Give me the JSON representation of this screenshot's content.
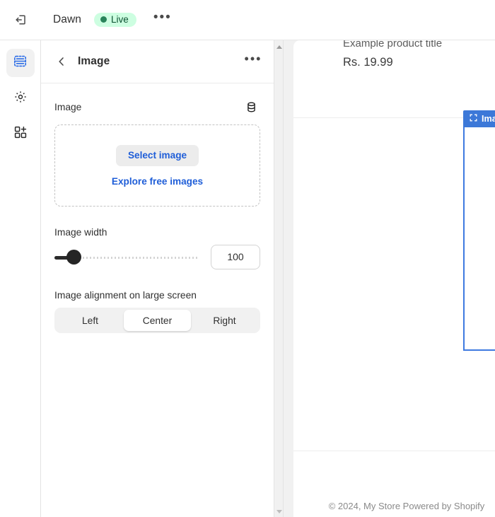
{
  "topbar": {
    "exit_icon": "exit-icon",
    "store_name": "Dawn",
    "status_badge": "Live",
    "more_label": "•••"
  },
  "rail": {
    "items": [
      {
        "name": "sections",
        "icon": "sections-icon",
        "active": true
      },
      {
        "name": "theme-settings",
        "icon": "gear-icon",
        "active": false
      },
      {
        "name": "apps",
        "icon": "apps-add-icon",
        "active": false
      }
    ]
  },
  "panel": {
    "back_icon": "chevron-left-icon",
    "title": "Image",
    "more_label": "•••",
    "image_field": {
      "label": "Image",
      "dynamic_source_icon": "database-icon",
      "select_button": "Select image",
      "explore_link": "Explore free images"
    },
    "image_width": {
      "label": "Image width",
      "value": "100",
      "slider_percent": 13
    },
    "alignment": {
      "label": "Image alignment on large screen",
      "options": [
        "Left",
        "Center",
        "Right"
      ],
      "selected": "Center"
    }
  },
  "scrollbar": {
    "up_arrow": "scroll-up-arrow",
    "down_arrow": "scroll-down-arrow"
  },
  "preview": {
    "product_title": "Example product title",
    "product_price": "Rs. 19.99",
    "selection_badge": "Image",
    "selection_badge_icon": "frame-icon",
    "footer": "© 2024, My Store Powered by Shopify"
  },
  "colors": {
    "accent_blue": "#1f5ed8",
    "selection_blue": "#3c78d8",
    "live_green_bg": "#cdfee1",
    "live_green_text": "#0c5132"
  }
}
